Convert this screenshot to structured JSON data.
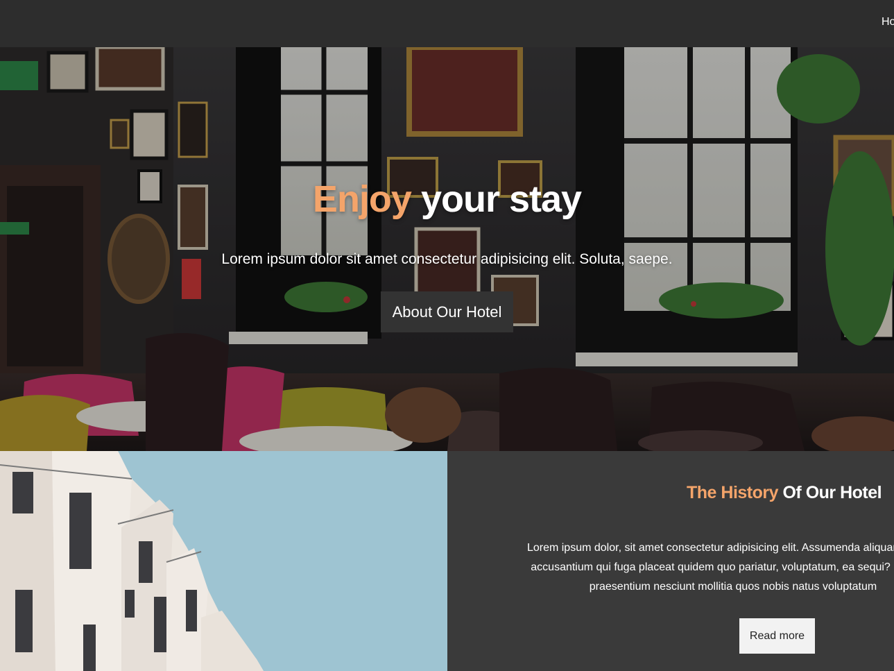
{
  "nav": {
    "link_label": "Ho"
  },
  "hero": {
    "title_accent": "Enjoy",
    "title_rest": " your stay",
    "subtitle": "Lorem ipsum dolor sit amet consectetur adipisicing elit. Soluta, saepe.",
    "button_label": "About Our Hotel"
  },
  "history": {
    "title_accent": "The History",
    "title_rest": " Of Our Hotel",
    "text_lines": [
      "Lorem ipsum dolor, sit amet consectetur adipisicing elit. Assumenda aliquam dolor a",
      "accusantium qui fuga placeat quidem quo pariatur, voluptatum, ea sequi? Corporis",
      "praesentium nesciunt mollitia quos nobis natus voluptatum"
    ],
    "button_label": "Read more"
  },
  "colors": {
    "accent": "#f4a46a",
    "navbar": "#2d2d2d",
    "panel": "#3a3a3a",
    "hero_button": "#333333"
  }
}
